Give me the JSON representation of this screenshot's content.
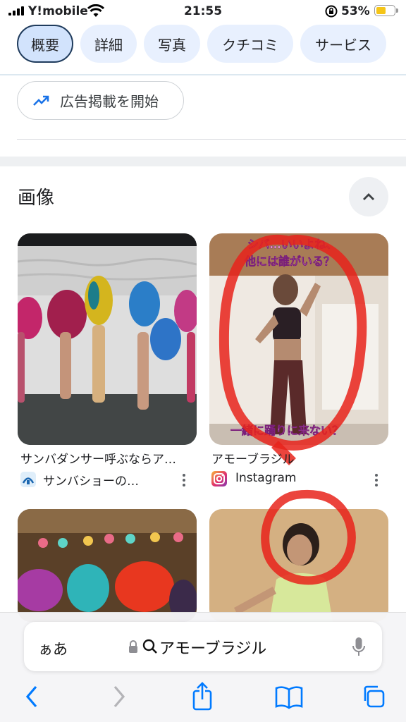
{
  "status_bar": {
    "carrier": "Y!mobile",
    "time": "21:55",
    "battery_pct": "53%",
    "battery_level": 0.53
  },
  "tabs": [
    {
      "label": "概要",
      "active": true
    },
    {
      "label": "詳細",
      "active": false
    },
    {
      "label": "写真",
      "active": false
    },
    {
      "label": "クチコミ",
      "active": false
    },
    {
      "label": "サービス",
      "active": false
    }
  ],
  "ad_button": {
    "label": "広告掲載を開始",
    "icon": "trending-up-icon"
  },
  "images_section": {
    "title": "画像",
    "collapse_icon": "chevron-up-icon",
    "cards": [
      {
        "caption": "サンバダンサー呼ぶならア…",
        "source": "サンバショーの…"
      },
      {
        "caption": "アモーブラジル",
        "source": "Instagram",
        "overlay_top_1": "シバ…いいよね、",
        "overlay_top_2": "他には誰がいる？",
        "overlay_bottom": "一緒に踊りに来ない？"
      },
      {
        "caption": "",
        "source": ""
      },
      {
        "caption": "",
        "source": ""
      }
    ]
  },
  "browser": {
    "aa_label": "ぁあ",
    "url_text": "アモーブラジル",
    "colors": {
      "accent": "#1a73e8",
      "chip_bg": "#e8f0fe",
      "chip_active_border": "#1f3b5c",
      "annotation_red": "#e8231b",
      "nav_blue": "#007aff"
    }
  }
}
